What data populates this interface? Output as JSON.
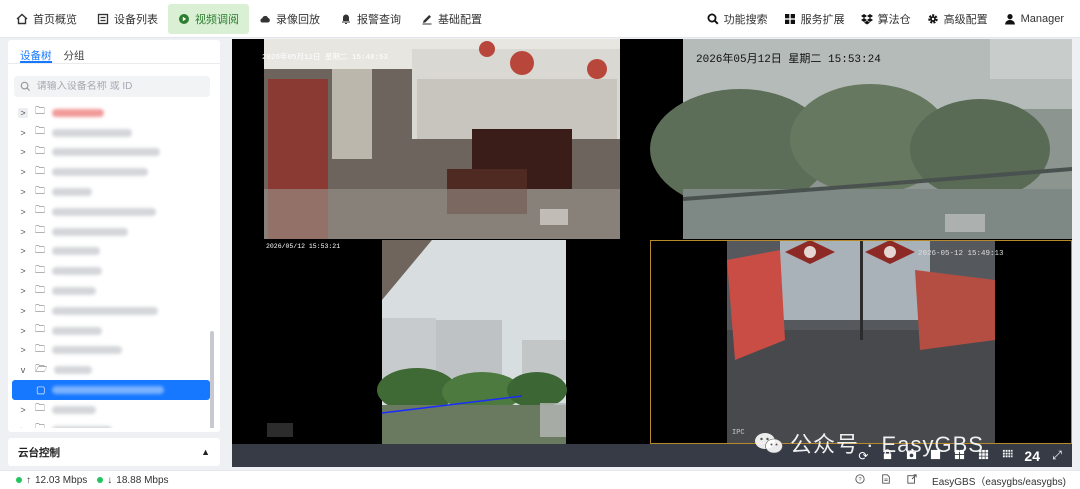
{
  "nav": {
    "left": [
      {
        "icon": "home-icon",
        "label": "首页概览",
        "active": false
      },
      {
        "icon": "list-icon",
        "label": "设备列表",
        "active": false
      },
      {
        "icon": "play-icon",
        "label": "视频调阅",
        "active": true
      },
      {
        "icon": "cloud-icon",
        "label": "录像回放",
        "active": false
      },
      {
        "icon": "bell-icon",
        "label": "报警查询",
        "active": false
      },
      {
        "icon": "edit-icon",
        "label": "基础配置",
        "active": false
      }
    ],
    "right": [
      {
        "icon": "search-icon",
        "label": "功能搜索"
      },
      {
        "icon": "grid-icon",
        "label": "服务扩展"
      },
      {
        "icon": "dropbox-icon",
        "label": "算法仓"
      },
      {
        "icon": "gear-icon",
        "label": "高级配置"
      },
      {
        "icon": "user-icon",
        "label": "Manager"
      }
    ],
    "active_color": "#2e7d32"
  },
  "sidebar": {
    "tabs": [
      {
        "label": "设备树",
        "active": true
      },
      {
        "label": "分组",
        "active": false
      }
    ],
    "search_placeholder": "请输入设备名称 或 ID",
    "accent": "#1677ff"
  },
  "ptz": {
    "title": "云台控制"
  },
  "video": {
    "cells": [
      {
        "timestamp": "2026年05月12日 星期二 15:48:53"
      },
      {
        "timestamp": "2026年05月12日  星期二  15:53:24"
      },
      {
        "timestamp": "2026/05/12 15:53:21"
      },
      {
        "timestamp": "2026-05-12 15:49:13",
        "corner_label": "IPC"
      }
    ],
    "layout_count": "24"
  },
  "watermark": {
    "text": "公众号 · EasyGBS"
  },
  "status": {
    "upload": "12.03 Mbps",
    "download": "18.88 Mbps",
    "product": "EasyGBS（easygbs/easygbs)"
  }
}
